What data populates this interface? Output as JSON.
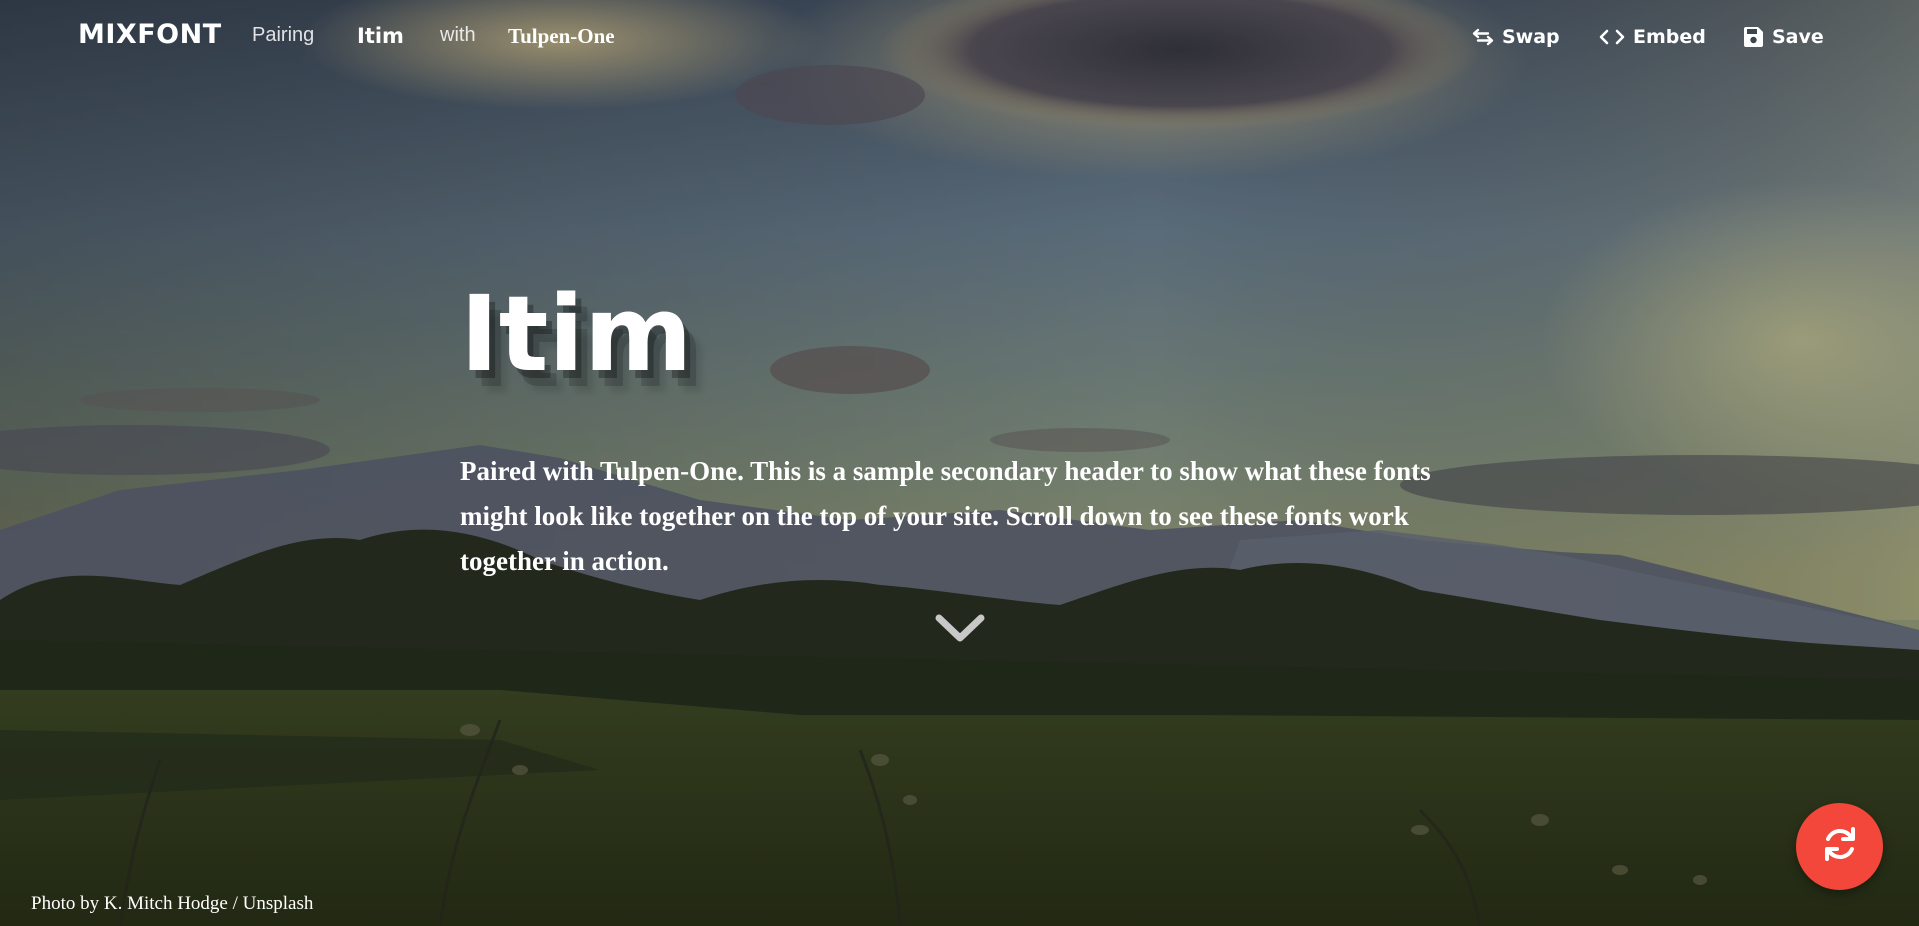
{
  "nav": {
    "logo": "MIXFONT",
    "pairing_label": "Pairing",
    "primary_font": "Itim",
    "with_label": "with",
    "secondary_font": "Tulpen-One",
    "actions": {
      "swap": "Swap",
      "embed": "Embed",
      "save": "Save"
    }
  },
  "hero": {
    "title": "Itim",
    "subtitle": "Paired with Tulpen-One. This is a sample secondary header to show what these fonts might look like together on the top of your site. Scroll down to see these fonts work together in action."
  },
  "credit": {
    "prefix": "Photo by ",
    "author": "K. Mitch Hodge",
    "separator": " / ",
    "source": "Unsplash"
  },
  "icons": {
    "swap": "swap-arrows-icon",
    "embed": "code-icon",
    "save": "floppy-disk-icon",
    "scroll": "chevron-down-icon",
    "refresh": "refresh-icon"
  },
  "colors": {
    "fab": "#f2473a",
    "text": "#ffffff"
  }
}
